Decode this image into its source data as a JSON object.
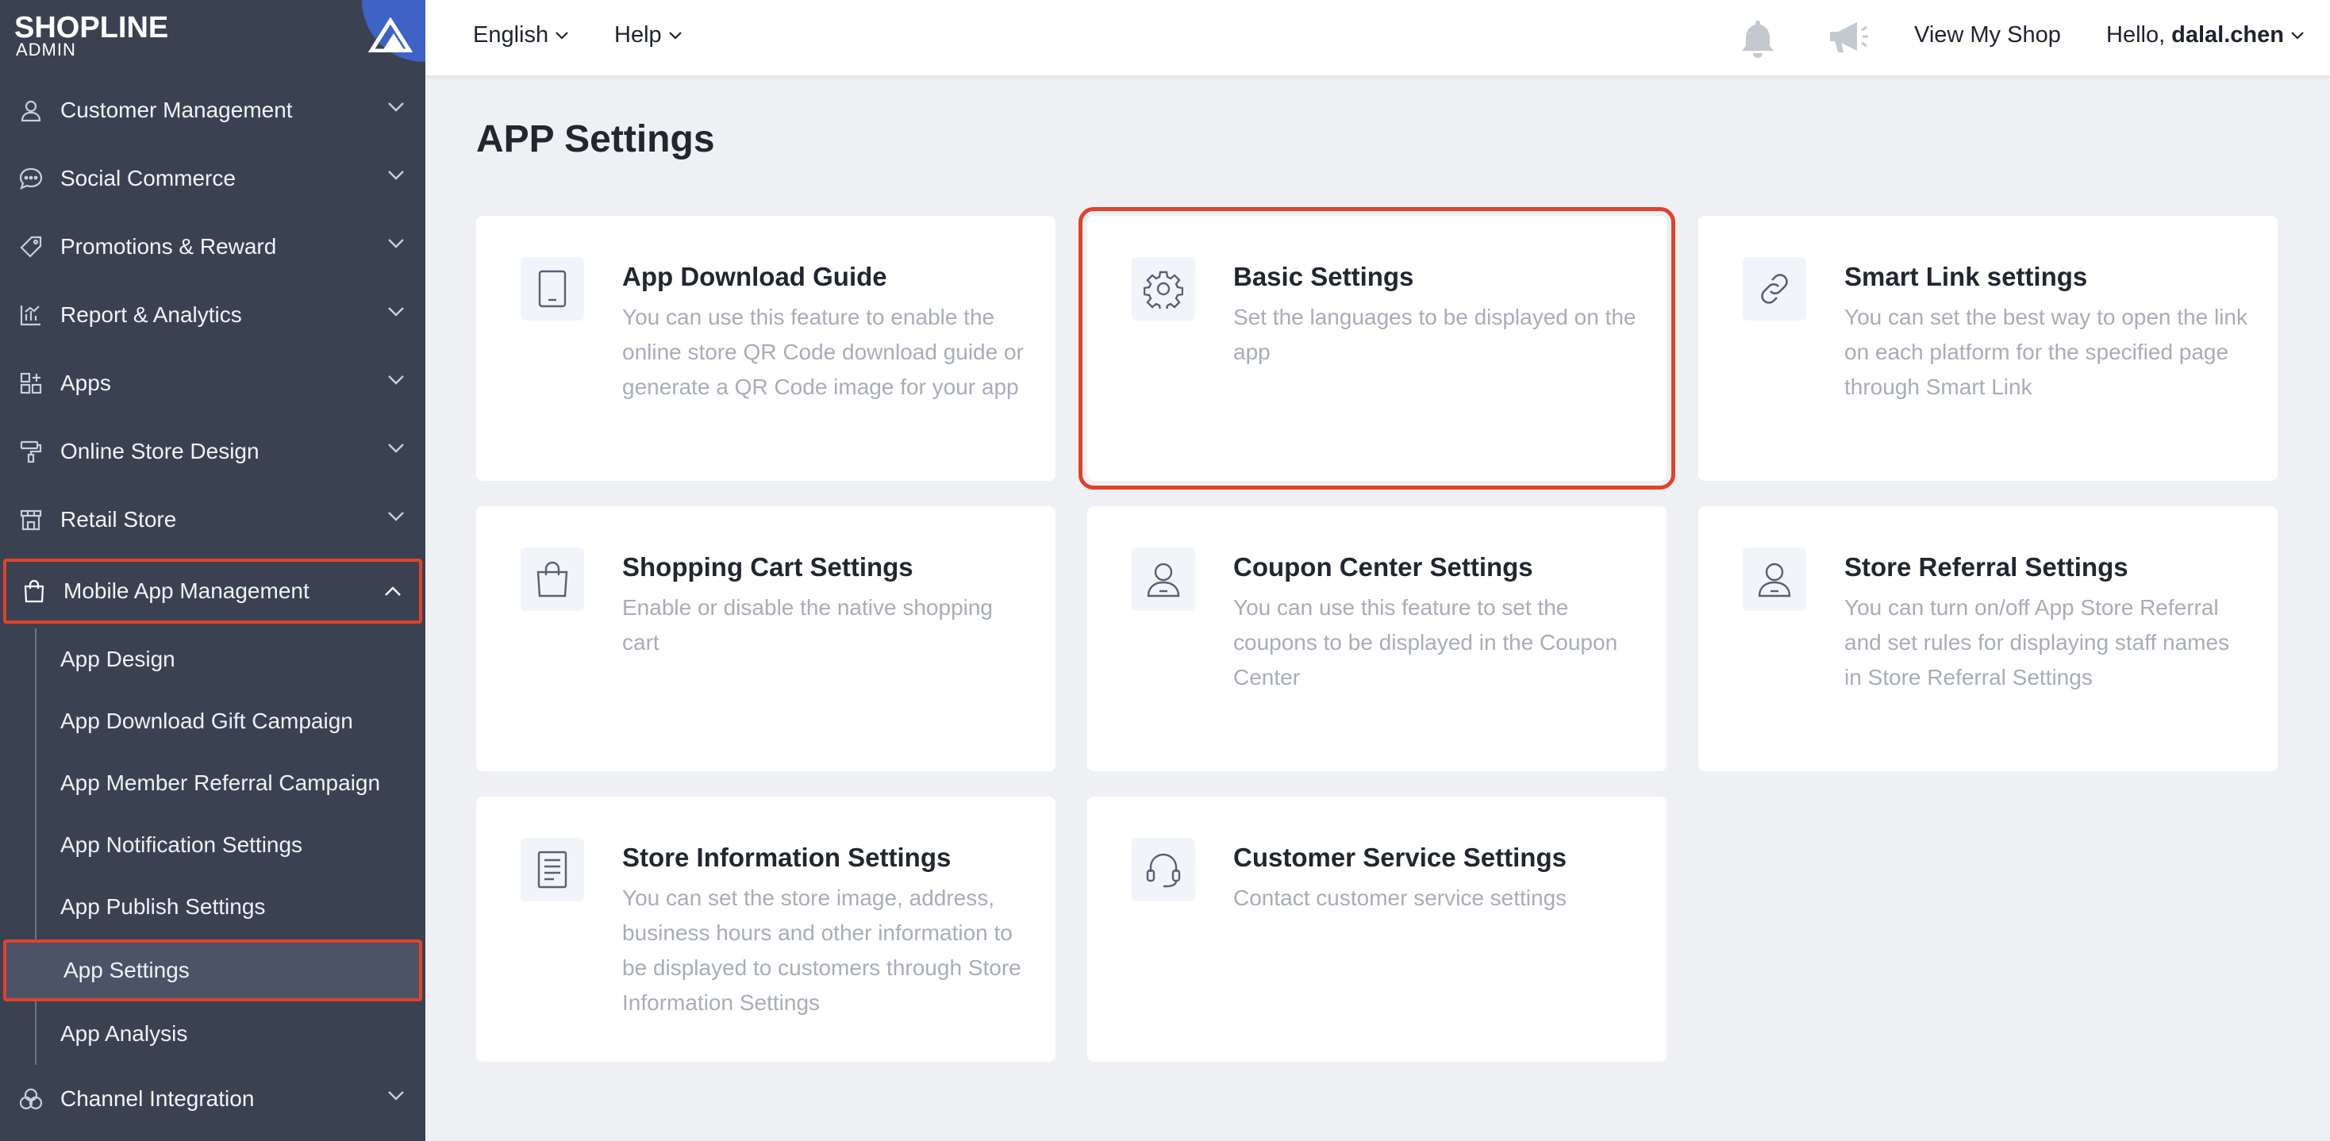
{
  "brand": {
    "name": "SHOPLINE",
    "sub": "ADMIN"
  },
  "sidebar": {
    "items": [
      {
        "label": "Customer Management",
        "icon": "user-icon"
      },
      {
        "label": "Social Commerce",
        "icon": "chat-bubble-icon"
      },
      {
        "label": "Promotions & Reward",
        "icon": "tag-icon"
      },
      {
        "label": "Report & Analytics",
        "icon": "bar-chart-icon"
      },
      {
        "label": "Apps",
        "icon": "apps-grid-icon"
      },
      {
        "label": "Online Store Design",
        "icon": "paint-roller-icon"
      },
      {
        "label": "Retail Store",
        "icon": "store-icon"
      },
      {
        "label": "Mobile App Management",
        "icon": "shopping-bag-icon"
      }
    ],
    "sub_items": [
      "App Design",
      "App Download Gift Campaign",
      "App Member Referral Campaign",
      "App Notification Settings",
      "App Publish Settings",
      "App Settings",
      "App Analysis"
    ],
    "after_items": [
      {
        "label": "Channel Integration",
        "icon": "circles-icon"
      }
    ]
  },
  "topbar": {
    "language": "English",
    "help": "Help",
    "view_shop": "View My Shop",
    "greeting": "Hello,",
    "username": "dalal.chen"
  },
  "page": {
    "title": "APP Settings"
  },
  "cards": [
    {
      "title": "App Download Guide",
      "desc": "You can use this feature to enable the online store QR Code download guide or generate a QR Code image for your app",
      "icon": "tablet-icon"
    },
    {
      "title": "Basic Settings",
      "desc": "Set the languages to be displayed on the app",
      "icon": "gear-icon"
    },
    {
      "title": "Smart Link settings",
      "desc": "You can set the best way to open the link on each platform for the specified page through Smart Link",
      "icon": "link-icon"
    },
    {
      "title": "Shopping Cart Settings",
      "desc": "Enable or disable the native shopping cart",
      "icon": "shopping-bag-icon"
    },
    {
      "title": "Coupon Center Settings",
      "desc": "You can use this feature to set the coupons to be displayed in the Coupon Center",
      "icon": "person-icon"
    },
    {
      "title": "Store Referral Settings",
      "desc": "You can turn on/off App Store Referral and set rules for displaying staff names in Store Referral Settings",
      "icon": "person-icon"
    },
    {
      "title": "Store Information Settings",
      "desc": "You can set the store image, address, business hours and other information to be displayed to customers through Store Information Settings",
      "icon": "document-icon"
    },
    {
      "title": "Customer Service Settings",
      "desc": "Contact customer service settings",
      "icon": "headset-icon"
    }
  ],
  "colors": {
    "sidebar_bg": "#3a4252",
    "highlight": "#e2412b",
    "brand_blue": "#3d63c6",
    "page_bg": "#eef0f3"
  }
}
